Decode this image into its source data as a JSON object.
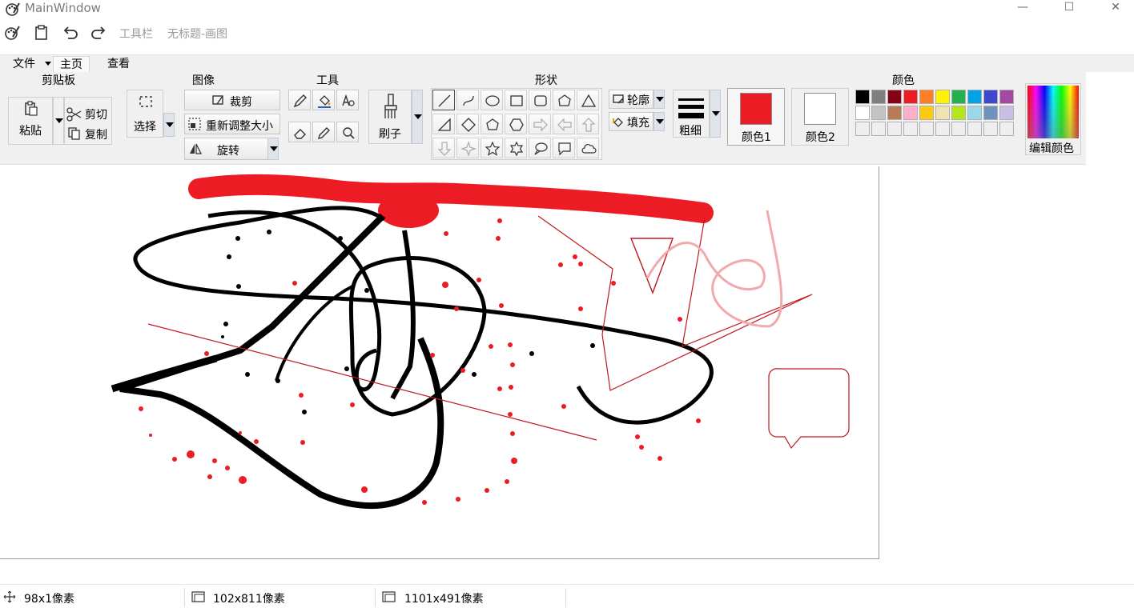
{
  "window": {
    "title": "MainWindow",
    "minimize": "—",
    "maximize": "☐",
    "close": "✕"
  },
  "quick_access": {
    "toolbar_label": "工具栏",
    "doc_title": "无标题-画图"
  },
  "tabs": [
    {
      "label": "文件"
    },
    {
      "label": "主页"
    },
    {
      "label": "查看"
    }
  ],
  "ribbon": {
    "clipboard": {
      "group": "剪贴板",
      "paste": "粘贴",
      "cut": "剪切",
      "copy": "复制"
    },
    "image": {
      "group": "图像",
      "select": "选择",
      "crop": "裁剪",
      "resize": "重新调整大小",
      "rotate": "旋转"
    },
    "tools": {
      "group": "工具",
      "brush": "刷子"
    },
    "shapes": {
      "group": "形状",
      "outline": "轮廓",
      "fill": "填充"
    },
    "size": {
      "label": "粗细"
    },
    "colors": {
      "group": "颜色",
      "color1_label": "颜色1",
      "color2_label": "颜色2",
      "edit": "编辑颜色",
      "color1": "#ed1c24",
      "color2": "#ffffff",
      "palette_row1": [
        "#000000",
        "#7f7f7f",
        "#880015",
        "#ed1c24",
        "#ff7f27",
        "#fff200",
        "#22b14c",
        "#00a2e8",
        "#3f48cc",
        "#a349a4"
      ],
      "palette_row2": [
        "#ffffff",
        "#c3c3c3",
        "#b97a57",
        "#ffaec9",
        "#ffc90e",
        "#efe4b0",
        "#b5e61d",
        "#99d9ea",
        "#7092be",
        "#c8bfe7"
      ],
      "palette_row3": [
        "#eeeeee",
        "#eeeeee",
        "#eeeeee",
        "#eeeeee",
        "#eeeeee",
        "#eeeeee",
        "#eeeeee",
        "#eeeeee",
        "#eeeeee",
        "#eeeeee"
      ]
    }
  },
  "status": {
    "cursor_pos": "98x1像素",
    "selection_size": "102x811像素",
    "canvas_size": "1101x491像素"
  }
}
